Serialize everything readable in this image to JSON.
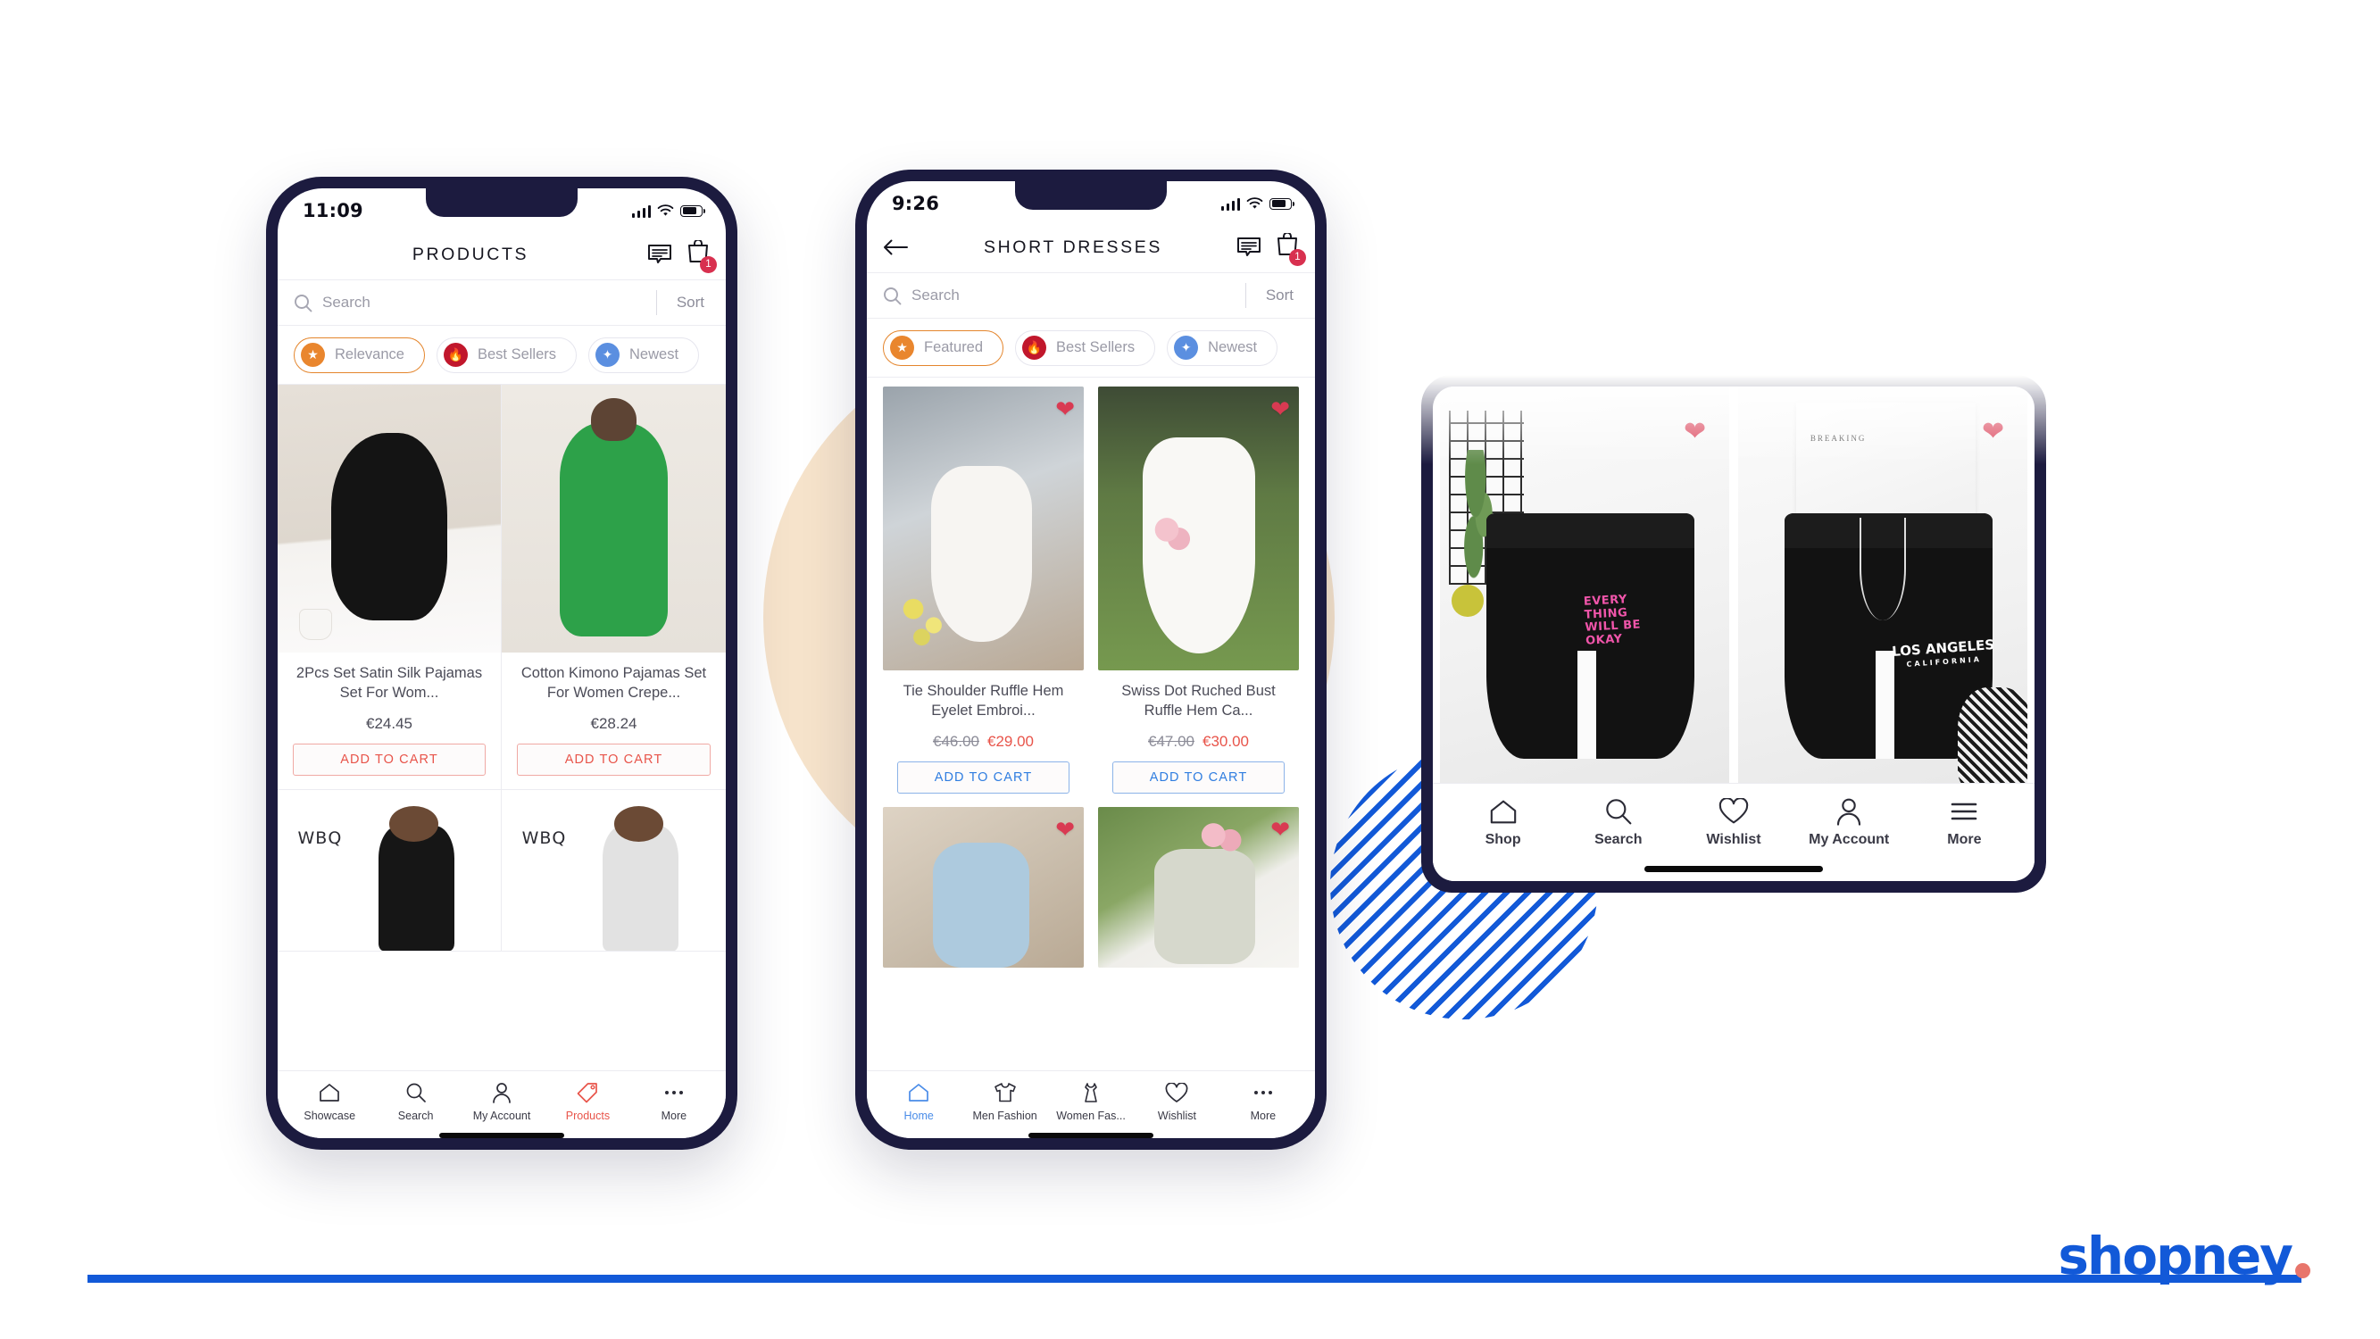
{
  "brand": {
    "word": "shopney",
    "color": "#1259d8",
    "dot_color": "#e8756b"
  },
  "phone1": {
    "status": {
      "time": "11:09"
    },
    "appbar": {
      "title": "PRODUCTS",
      "chat_icon": "chat-bubble-icon",
      "bag_icon": "shopping-bag-icon",
      "bag_badge": "1"
    },
    "search": {
      "placeholder": "Search",
      "sort_label": "Sort"
    },
    "chips": [
      {
        "label": "Relevance",
        "icon": "star-icon",
        "active": true
      },
      {
        "label": "Best Sellers",
        "icon": "flame-icon",
        "active": false
      },
      {
        "label": "Newest",
        "icon": "party-popper-icon",
        "active": false
      }
    ],
    "products": [
      {
        "title": "2Pcs Set Satin Silk Pajamas Set  For Wom...",
        "price": "€24.45",
        "cta": "ADD TO CART"
      },
      {
        "title": "Cotton Kimono Pajamas Set For Women Crepe...",
        "price": "€28.24",
        "cta": "ADD TO CART"
      }
    ],
    "row2_watermark": "WBQ",
    "tabs": [
      {
        "label": "Showcase",
        "icon": "home-icon",
        "active": false
      },
      {
        "label": "Search",
        "icon": "search-icon",
        "active": false
      },
      {
        "label": "My Account",
        "icon": "person-icon",
        "active": false
      },
      {
        "label": "Products",
        "icon": "price-tag-icon",
        "active": true
      },
      {
        "label": "More",
        "icon": "more-dots-icon",
        "active": false
      }
    ]
  },
  "phone2": {
    "status": {
      "time": "9:26"
    },
    "appbar": {
      "title": "SHORT DRESSES",
      "back_icon": "arrow-left-icon",
      "chat_icon": "chat-bubble-icon",
      "bag_icon": "shopping-bag-icon",
      "bag_badge": "1"
    },
    "search": {
      "placeholder": "Search",
      "sort_label": "Sort"
    },
    "chips": [
      {
        "label": "Featured",
        "icon": "star-icon",
        "active": true
      },
      {
        "label": "Best Sellers",
        "icon": "flame-icon",
        "active": false
      },
      {
        "label": "Newest",
        "icon": "party-popper-icon",
        "active": false
      }
    ],
    "products": [
      {
        "title": "Tie Shoulder Ruffle Hem Eyelet Embroi...",
        "old_price": "€46.00",
        "price": "€29.00",
        "cta": "ADD TO CART"
      },
      {
        "title": "Swiss Dot Ruched Bust Ruffle Hem Ca...",
        "old_price": "€47.00",
        "price": "€30.00",
        "cta": "ADD TO CART"
      }
    ],
    "tabs": [
      {
        "label": "Home",
        "icon": "home-icon",
        "active": true
      },
      {
        "label": "Men Fashion",
        "icon": "tshirt-icon",
        "active": false
      },
      {
        "label": "Women Fas...",
        "icon": "dress-icon",
        "active": false
      },
      {
        "label": "Wishlist",
        "icon": "heart-icon",
        "active": false
      },
      {
        "label": "More",
        "icon": "more-dots-icon",
        "active": false
      }
    ]
  },
  "device3": {
    "products": [
      {
        "print_line1": "EVERY",
        "print_line2": "THING",
        "print_line3": "WILL BE",
        "print_line4": "OKAY",
        "wishlist_icon": "heart-filled-icon"
      },
      {
        "print_big": "LOS ANGELES",
        "print_small": "CALIFORNIA",
        "magazine_text": "BREAKING",
        "wishlist_icon": "heart-filled-icon"
      }
    ],
    "tabs": [
      {
        "label": "Shop",
        "icon": "home-icon"
      },
      {
        "label": "Search",
        "icon": "search-icon"
      },
      {
        "label": "Wishlist",
        "icon": "heart-icon"
      },
      {
        "label": "My Account",
        "icon": "person-icon"
      },
      {
        "label": "More",
        "icon": "hamburger-icon"
      }
    ]
  }
}
